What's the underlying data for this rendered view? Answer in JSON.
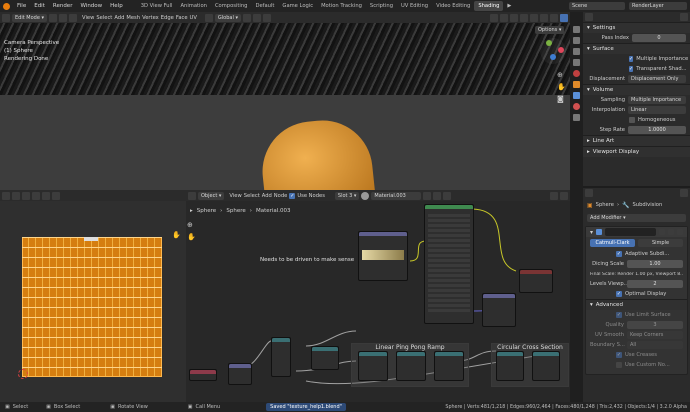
{
  "topbar": {
    "menus": [
      "File",
      "Edit",
      "Render",
      "Window",
      "Help"
    ],
    "workspaces": [
      "3D View Full",
      "Animation",
      "Compositing",
      "Default",
      "Game Logic",
      "Motion Tracking",
      "Scripting",
      "UV Editing",
      "Video Editing",
      "Shading"
    ],
    "active_workspace": "Shading",
    "scene": "Scene",
    "view_layer": "RenderLayer"
  },
  "viewport": {
    "mode": "Edit Mode",
    "menus": [
      "View",
      "Select",
      "Add",
      "Mesh",
      "Vertex",
      "Edge",
      "Face",
      "UV"
    ],
    "transform": "Global",
    "options": "Options",
    "info_lines": [
      "Camera Perspective",
      "(1) Sphere",
      "Rendering Done"
    ]
  },
  "props_top": {
    "settings": "Settings",
    "pass_index_label": "Pass Index",
    "pass_index_value": "0",
    "surface": "Surface",
    "multiple_importance": "Multiple Importance",
    "transparent_shadows": "Transparent Shad...",
    "displacement_label": "Displacement",
    "displacement_value": "Displacement Only",
    "volume": "Volume",
    "sampling_label": "Sampling",
    "sampling_value": "Multiple Importance",
    "interpolation_label": "Interpolation",
    "interpolation_value": "Linear",
    "homogeneous": "Homogeneous",
    "step_rate_label": "Step Rate",
    "step_rate_value": "1.0000",
    "line_art": "Line Art",
    "viewport_display": "Viewport Display"
  },
  "props_bottom": {
    "breadcrumb_obj": "Sphere",
    "breadcrumb_mod": "Subdivision",
    "add_modifier": "Add Modifier",
    "tab_cc": "Catmull-Clark",
    "tab_simple": "Simple",
    "adaptive": "Adaptive Subdi...",
    "dicing_label": "Dicing Scale",
    "dicing_value": "1.00",
    "final_scale": "Final Scale: Render 1.00 px, Viewport 8...",
    "levels_label": "Levels Viewp...",
    "levels_value": "2",
    "optimal": "Optimal Display",
    "advanced": "Advanced",
    "use_limit": "Use Limit Surface",
    "quality_label": "Quality",
    "quality_value": "3",
    "uv_smooth_label": "UV Smooth",
    "uv_smooth_value": "Keep Corners",
    "boundary_label": "Boundary S...",
    "boundary_value": "All",
    "use_creases": "Use Creases",
    "use_custom": "Use Custom No..."
  },
  "node_editor": {
    "object": "Object",
    "menus": [
      "View",
      "Select",
      "Add",
      "Node"
    ],
    "use_nodes": "Use Nodes",
    "slot": "Slot 3",
    "material": "Material.003",
    "breadcrumb": [
      "Sphere",
      "Sphere",
      "Material.003"
    ],
    "annotation": "Needs to be driven to make sense",
    "frame1": "Linear Ping Pong Ramp",
    "frame2": "Circular Cross Section"
  },
  "status": {
    "select": "Select",
    "box_select": "Box Select",
    "rotate_view": "Rotate View",
    "call_menu": "Call Menu",
    "saved": "Saved \"texture_help1.blend\"",
    "stats": "Sphere | Verts:481/1,218 | Edges:960/2,464 | Faces:480/1,248 | Tris:2,432 | Objects:1/4 | 3.2.0 Alpha"
  },
  "colors": {
    "accent": "#4772b3",
    "header": "#2b2b2b",
    "orange": "#e0902a"
  }
}
